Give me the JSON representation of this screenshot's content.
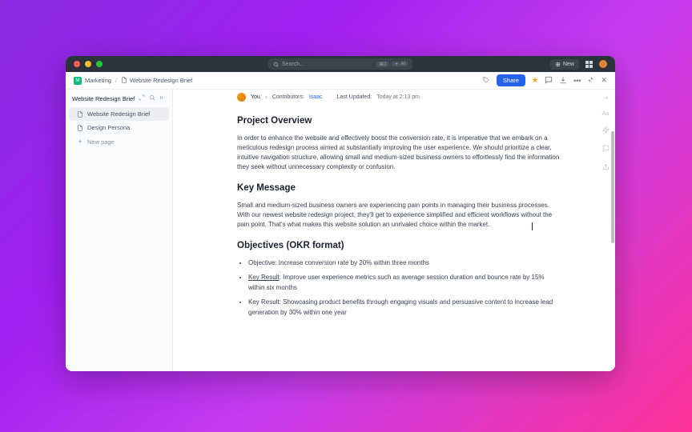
{
  "titlebar": {
    "search_placeholder": "Search…",
    "search_kbd": "⌘J",
    "ai_label": "AI",
    "new_label": "New"
  },
  "breadcrumb": {
    "space_initial": "M",
    "space": "Marketing",
    "page": "Website Redesign Brief",
    "share": "Share"
  },
  "sidebar": {
    "title": "Website Redesign Brief",
    "items": [
      {
        "label": "Website Redesign Brief"
      },
      {
        "label": "Design Persona"
      }
    ],
    "new_page": "New page"
  },
  "meta": {
    "you": "You",
    "contributors_label": "Contributors:",
    "contributors": "Isaac",
    "updated_label": "Last Updated:",
    "updated_value": "Today at 2:13 pm"
  },
  "doc": {
    "h1": "Project Overview",
    "p1": "In order to enhance the website and effectively boost the conversion rate, it is imperative that we embark on a meticulous redesign process aimed at substantially improving the user experience. We should prioritize a clear, intuitive navigation structure, allowing small and medium-sized business owners to effortlessly find the information they seek without unnecessary complexity or confusion.",
    "h2": "Key Message",
    "p2": "Small and medium-sized business owners are experiencing pain points in managing their business processes. With our newest website redesign project, they'll get to experience simplified and efficient workflows without the pain point. That's what makes this website solution an unrivaled choice within the market.",
    "h3": "Objectives (OKR format)",
    "obj1": "Objective: Increase conversion rate by 20% within three months",
    "kr_label": "Key Result",
    "obj2": ": Improve user experience metrics such as average session duration and bounce rate by 15% within six months",
    "obj3": "Key Result: Showcasing product benefits through engaging visuals and persuasive content to increase lead generation by 30% within one year"
  }
}
